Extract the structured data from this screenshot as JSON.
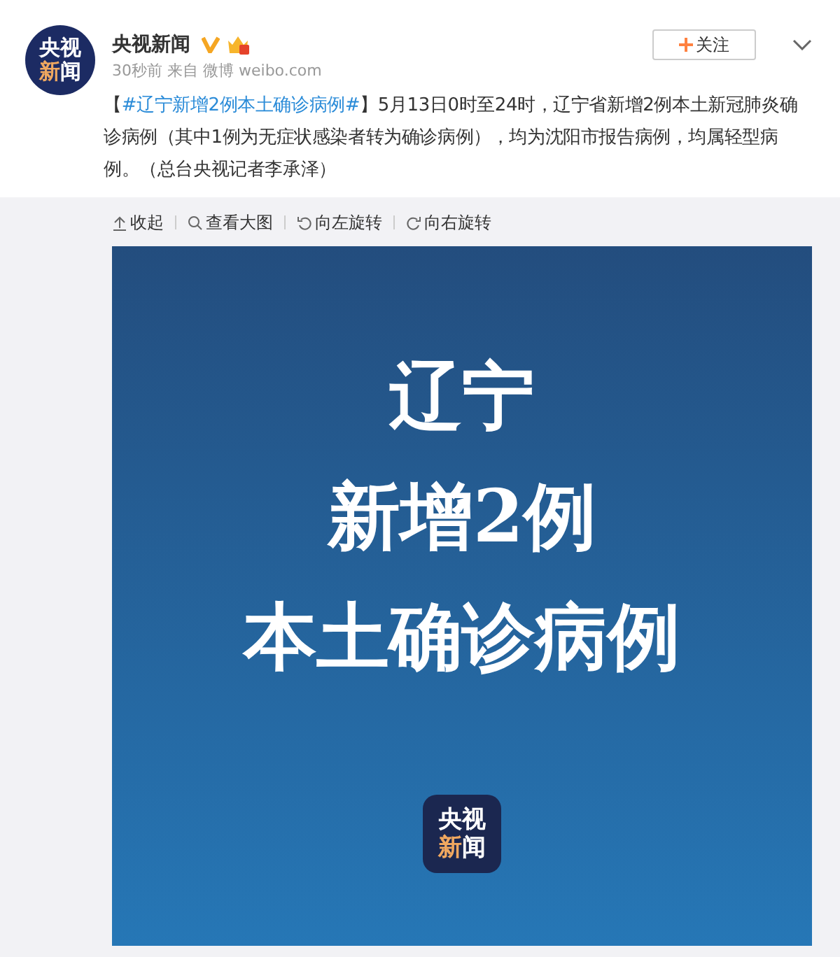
{
  "post": {
    "avatar": {
      "top": "央视",
      "bottom_left": "新",
      "bottom_right": "闻"
    },
    "author": "央视新闻",
    "verified": true,
    "follow_button": "关注",
    "time": "30秒前",
    "source_prefix": "来自",
    "source": "微博 weibo.com",
    "hashtag": "#辽宁新增2例本土确诊病例#",
    "bracket_open": "【",
    "bracket_close": "】",
    "body": "5月13日0时至24时，辽宁省新增2例本土新冠肺炎确诊病例（其中1例为无症状感染者转为确诊病例），均为沈阳市报告病例，均属轻型病例。（总台央视记者李承泽）"
  },
  "image_toolbar": [
    {
      "kind": "collapse",
      "label": "收起"
    },
    {
      "kind": "zoom",
      "label": "查看大图"
    },
    {
      "kind": "rotate-left",
      "label": "向左旋转"
    },
    {
      "kind": "rotate-right",
      "label": "向右旋转"
    }
  ],
  "image": {
    "headline": [
      "辽宁",
      "新增2例",
      "本土确诊病例"
    ],
    "logo": {
      "top": "央视",
      "bottom_left": "新",
      "bottom_right": "闻"
    }
  }
}
